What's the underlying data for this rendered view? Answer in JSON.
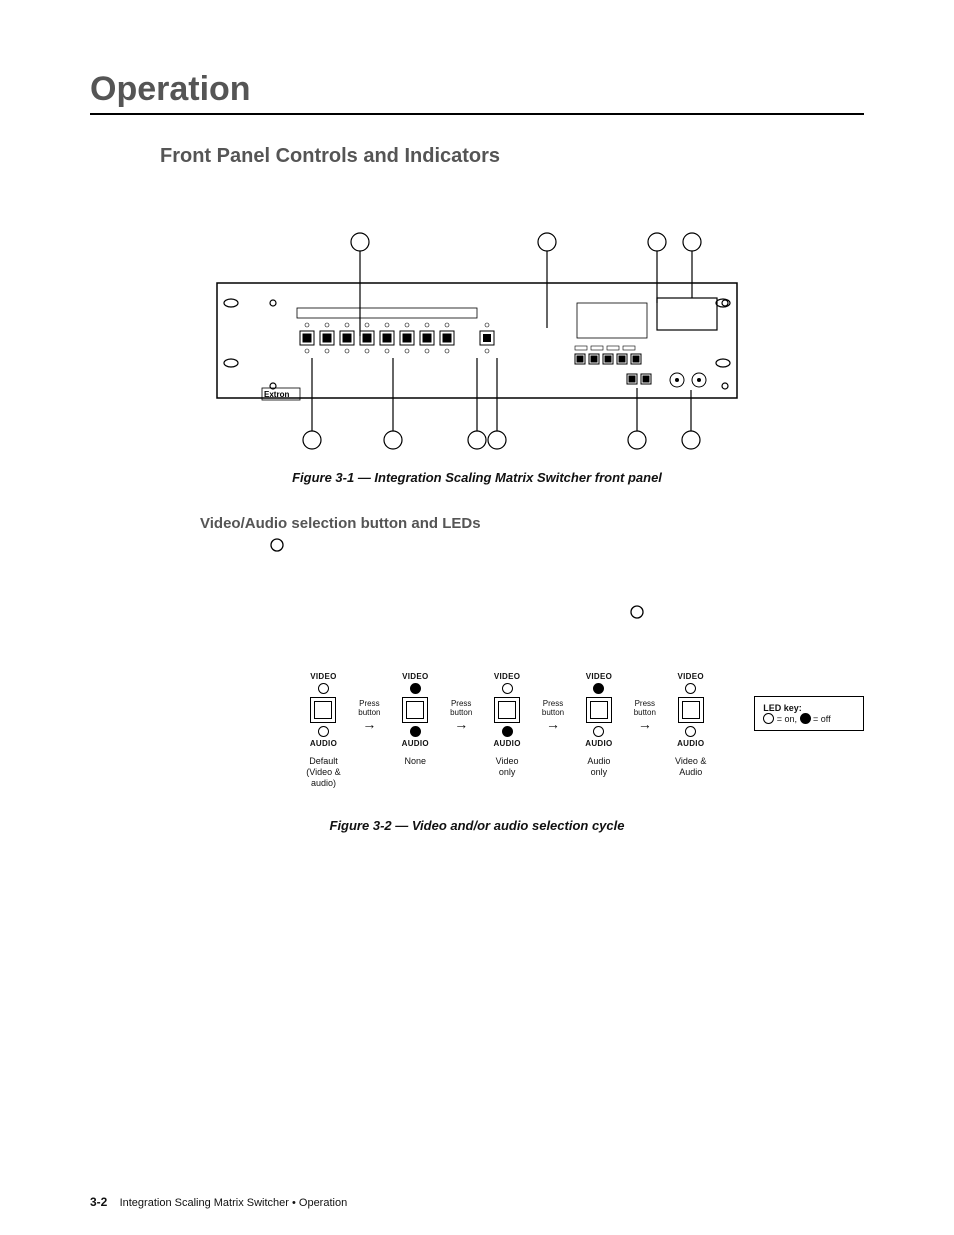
{
  "headings": {
    "chapter": "Operation",
    "section": "Front Panel Controls and Indicators",
    "subsection": "Video/Audio selection button and LEDs"
  },
  "figure1": {
    "caption": "Figure 3-1 — Integration Scaling Matrix Switcher front panel",
    "brand": "Extron"
  },
  "figure2": {
    "caption": "Figure 3-2 — Video and/or audio selection cycle",
    "top_label": "VIDEO",
    "bottom_label": "AUDIO",
    "press": "Press button",
    "ledkey_title": "LED key:",
    "ledkey_on": "= on,",
    "ledkey_off": "= off",
    "states": [
      {
        "video": "on",
        "audio": "on",
        "caption_a": "Default",
        "caption_b": "(Video &",
        "caption_c": "audio)"
      },
      {
        "video": "off",
        "audio": "off",
        "caption_a": "None",
        "caption_b": "",
        "caption_c": ""
      },
      {
        "video": "on",
        "audio": "off",
        "caption_a": "Video",
        "caption_b": "only",
        "caption_c": ""
      },
      {
        "video": "off",
        "audio": "on",
        "caption_a": "Audio",
        "caption_b": "only",
        "caption_c": ""
      },
      {
        "video": "on",
        "audio": "on",
        "caption_a": "Video &",
        "caption_b": "Audio",
        "caption_c": ""
      }
    ]
  },
  "footer": {
    "page": "3-2",
    "text": "Integration Scaling Matrix Switcher • Operation"
  }
}
